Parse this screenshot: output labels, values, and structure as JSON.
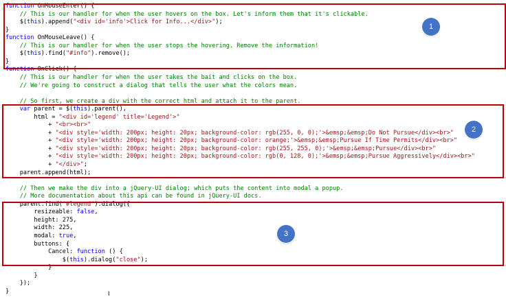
{
  "editor": {
    "lines": [
      [
        [
          "kw",
          "function"
        ],
        [
          "pl",
          " OnMouseEnter() {"
        ]
      ],
      [
        [
          "pl",
          "    "
        ],
        [
          "cm",
          "// This is our handler for when the user hovers on the box. Let's inform them that it's clickable."
        ]
      ],
      [
        [
          "pl",
          "    $("
        ],
        [
          "kw",
          "this"
        ],
        [
          "pl",
          ").append("
        ],
        [
          "st",
          "\"<div id='info'>Click for Info...</div>\""
        ],
        [
          "pl",
          ");"
        ]
      ],
      [
        [
          "pl",
          "}"
        ]
      ],
      [
        [
          "kw",
          "function"
        ],
        [
          "pl",
          " OnMouseLeave() {"
        ]
      ],
      [
        [
          "pl",
          "    "
        ],
        [
          "cm",
          "// This is our handler for when the user stops the hovering. Remove the information!"
        ]
      ],
      [
        [
          "pl",
          "    $("
        ],
        [
          "kw",
          "this"
        ],
        [
          "pl",
          ").find("
        ],
        [
          "st",
          "\"#info\""
        ],
        [
          "pl",
          ").remove();"
        ]
      ],
      [
        [
          "pl",
          "}"
        ]
      ],
      [
        [
          "kw",
          "function"
        ],
        [
          "pl",
          " OnClick() {"
        ]
      ],
      [
        [
          "pl",
          "    "
        ],
        [
          "cm",
          "// This is our handler for when the user takes the bait and clicks on the box."
        ]
      ],
      [
        [
          "pl",
          "    "
        ],
        [
          "cm",
          "// We're going to construct a dialog that tells the user what the colors mean."
        ]
      ],
      [
        [
          "pl",
          ""
        ]
      ],
      [
        [
          "pl",
          "    "
        ],
        [
          "cm",
          "// So first, we create a div with the correct html and attach it to the parent."
        ]
      ],
      [
        [
          "pl",
          "    "
        ],
        [
          "kw",
          "var"
        ],
        [
          "pl",
          " parent = $("
        ],
        [
          "kw",
          "this"
        ],
        [
          "pl",
          ").parent(),"
        ]
      ],
      [
        [
          "pl",
          "        html = "
        ],
        [
          "st",
          "\"<div id='legend' title='Legend'>\""
        ]
      ],
      [
        [
          "pl",
          "            + "
        ],
        [
          "st",
          "\"<br><br>\""
        ]
      ],
      [
        [
          "pl",
          "            + "
        ],
        [
          "st",
          "\"<div style='width: 200px; height: 20px; background-color: rgb(255, 0, 0);'>&emsp;&emsp;Do Not Pursue</div><br>\""
        ]
      ],
      [
        [
          "pl",
          "            + "
        ],
        [
          "st",
          "\"<div style='width: 200px; height: 20px; background-color: orange;'>&emsp;&emsp;Pursue If Time Permits</div><br>\""
        ]
      ],
      [
        [
          "pl",
          "            + "
        ],
        [
          "st",
          "\"<div style='width: 200px; height: 20px; background-color: rgb(255, 255, 0);'>&emsp;&emsp;Pursue</div><br>\""
        ]
      ],
      [
        [
          "pl",
          "            + "
        ],
        [
          "st",
          "\"<div style='width: 200px; height: 20px; background-color: rgb(0, 128, 0);'>&emsp;&emsp;Pursue Aggressively</div><br>\""
        ]
      ],
      [
        [
          "pl",
          "            + "
        ],
        [
          "st",
          "\"</div>\""
        ],
        [
          "pl",
          ";"
        ]
      ],
      [
        [
          "pl",
          "    parent.append(html);"
        ]
      ],
      [
        [
          "pl",
          ""
        ]
      ],
      [
        [
          "pl",
          "    "
        ],
        [
          "cm",
          "// Then we make the div into a jQuery-UI dialog; which puts the content into modal a popup."
        ]
      ],
      [
        [
          "pl",
          "    "
        ],
        [
          "cm",
          "// More documentation about this api can be found in jQuery-UI docs."
        ]
      ],
      [
        [
          "pl",
          "    parent.find("
        ],
        [
          "st",
          "\"#legend\""
        ],
        [
          "pl",
          ").dialog({"
        ]
      ],
      [
        [
          "pl",
          "        resizeable: "
        ],
        [
          "kw",
          "false"
        ],
        [
          "pl",
          ","
        ]
      ],
      [
        [
          "pl",
          "        height: 275,"
        ]
      ],
      [
        [
          "pl",
          "        width: 225,"
        ]
      ],
      [
        [
          "pl",
          "        modal: "
        ],
        [
          "kw",
          "true"
        ],
        [
          "pl",
          ","
        ]
      ],
      [
        [
          "pl",
          "        buttons: {"
        ]
      ],
      [
        [
          "pl",
          "            Cancel: "
        ],
        [
          "kw",
          "function"
        ],
        [
          "pl",
          " () {"
        ]
      ],
      [
        [
          "pl",
          "                $("
        ],
        [
          "kw",
          "this"
        ],
        [
          "pl",
          ").dialog("
        ],
        [
          "st",
          "\"close\""
        ],
        [
          "pl",
          ");"
        ]
      ],
      [
        [
          "pl",
          "            }"
        ]
      ],
      [
        [
          "pl",
          "        }"
        ]
      ],
      [
        [
          "pl",
          "    });"
        ]
      ],
      [
        [
          "pl",
          "}"
        ]
      ]
    ]
  },
  "annotations": [
    {
      "label": "1"
    },
    {
      "label": "2"
    },
    {
      "label": "3"
    }
  ],
  "cursor": {
    "glyph": "I"
  },
  "colors": {
    "keyword": "#0000ff",
    "comment": "#008000",
    "string": "#a31515",
    "highlight_box": "#c00000",
    "badge": "#4472c4"
  }
}
